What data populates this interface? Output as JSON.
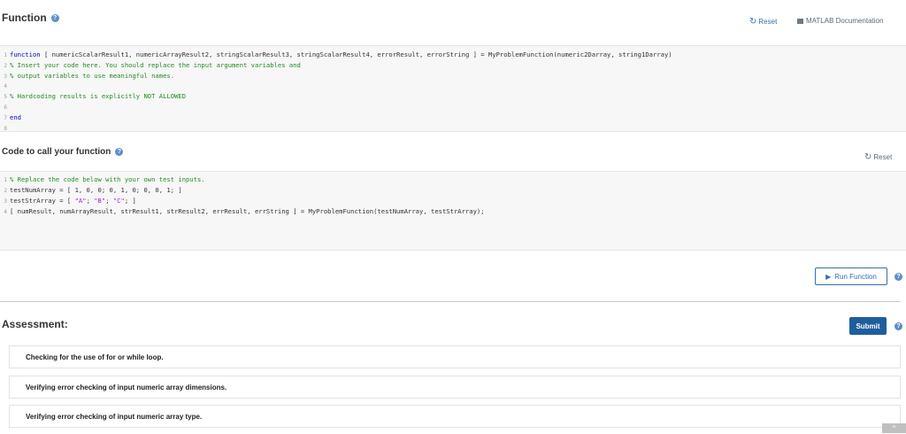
{
  "function_section": {
    "title": "Function",
    "reset_label": "Reset",
    "doc_label": "MATLAB Documentation",
    "code_lines": [
      {
        "num": "1",
        "segments": [
          {
            "cls": "kw",
            "text": "function"
          },
          {
            "cls": "plain",
            "text": " [ numericScalarResult1, numericArrayResult2, stringScalarResult3, stringScalarResult4, errorResult, errorString ] = MyProblemFunction(numeric2Darray, string1Darray)"
          }
        ]
      },
      {
        "num": "2",
        "segments": [
          {
            "cls": "cm",
            "text": "% Insert your code here. You should replace the input argument variables and"
          }
        ]
      },
      {
        "num": "3",
        "segments": [
          {
            "cls": "cm",
            "text": "% output variables to use meaningful names."
          }
        ]
      },
      {
        "num": "4",
        "segments": [
          {
            "cls": "plain",
            "text": ""
          }
        ]
      },
      {
        "num": "5",
        "segments": [
          {
            "cls": "cm",
            "text": "% Hardcoding results is explicitly NOT ALLOWED"
          }
        ]
      },
      {
        "num": "6",
        "segments": [
          {
            "cls": "plain",
            "text": ""
          }
        ]
      },
      {
        "num": "7",
        "segments": [
          {
            "cls": "kw",
            "text": "end"
          }
        ]
      },
      {
        "num": "8",
        "segments": [
          {
            "cls": "plain",
            "text": ""
          }
        ]
      }
    ]
  },
  "call_section": {
    "title": "Code to call your function",
    "reset_label": "Reset",
    "code_lines": [
      {
        "num": "1",
        "segments": [
          {
            "cls": "cm",
            "text": "% Replace the code below with your own test inputs."
          }
        ]
      },
      {
        "num": "2",
        "segments": [
          {
            "cls": "plain",
            "text": "testNumArray = [ 1, 0, 0; 0, 1, 0; 0, 0, 1; ]"
          }
        ]
      },
      {
        "num": "3",
        "segments": [
          {
            "cls": "plain",
            "text": "testStrArray = [ "
          },
          {
            "cls": "str",
            "text": "\"A\""
          },
          {
            "cls": "plain",
            "text": "; "
          },
          {
            "cls": "str",
            "text": "\"B\""
          },
          {
            "cls": "plain",
            "text": "; "
          },
          {
            "cls": "str",
            "text": "\"C\""
          },
          {
            "cls": "plain",
            "text": "; ]"
          }
        ]
      },
      {
        "num": "4",
        "segments": [
          {
            "cls": "plain",
            "text": "[ numResult, numArrayResult, strResult1, strResult2, errResult, errString ] = MyProblemFunction(testNumArray, testStrArray);"
          }
        ]
      }
    ]
  },
  "run_label": "Run Function",
  "assessment": {
    "title": "Assessment:",
    "submit_label": "Submit",
    "checks": [
      "Checking for the use of for or while loop.",
      "Verifying error checking of input numeric array dimensions.",
      "Verifying error checking of input numeric array type."
    ]
  },
  "icons": {
    "help": "help-circle-icon",
    "refresh": "refresh-icon",
    "document": "document-icon",
    "play": "play-icon",
    "scroll_top": "chevron-up-icon"
  },
  "colors": {
    "accent": "#3a6ea8",
    "submit_bg": "#1e5e9c",
    "keyword": "#0000cc",
    "comment": "#228b22",
    "string": "#a020f0"
  }
}
